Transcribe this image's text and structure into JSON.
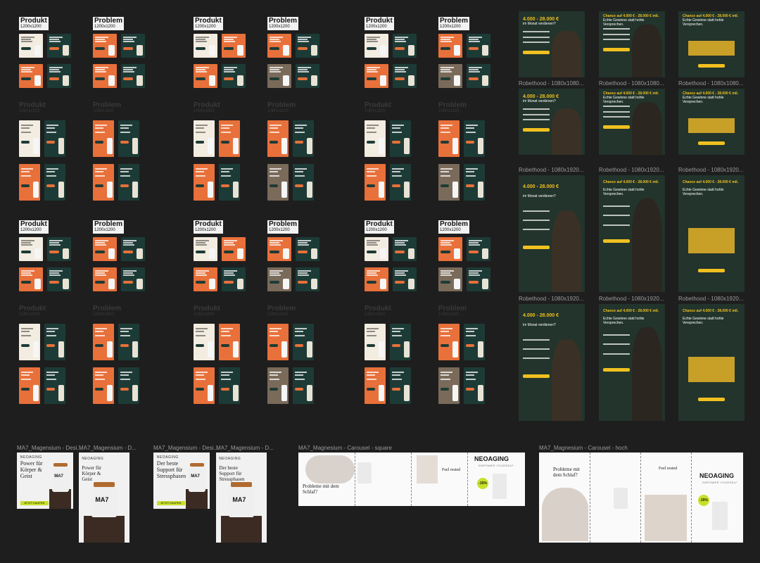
{
  "label_boxes": [
    {
      "title": "Produkt",
      "size": "1200x1200"
    },
    {
      "title": "Problem",
      "size": "1200x1200"
    },
    {
      "title": "Produkt",
      "size": "1200x1200"
    },
    {
      "title": "Problem",
      "size": "1200x1200"
    },
    {
      "title": "Produkt",
      "size": "1200x1200"
    },
    {
      "title": "Problem",
      "size": "1200x1200"
    },
    {
      "title": "Produkt",
      "size": "1200x1200"
    },
    {
      "title": "Problem",
      "size": "1200x1200"
    },
    {
      "title": "Produkt",
      "size": "1200x1200"
    },
    {
      "title": "Problem",
      "size": "1200x1200"
    },
    {
      "title": "Produkt",
      "size": "1200x1200"
    },
    {
      "title": "Problem",
      "size": "1200x1200"
    }
  ],
  "ghost_labels": [
    {
      "title": "Produkt",
      "size": "1080x1920"
    },
    {
      "title": "Problem",
      "size": "1080x1920"
    },
    {
      "title": "Produkt",
      "size": "1080x1920"
    },
    {
      "title": "Problem",
      "size": "1080x1920"
    },
    {
      "title": "Produkt",
      "size": "1080x1920"
    },
    {
      "title": "Problem",
      "size": "1080x1920"
    },
    {
      "title": "Produkt",
      "size": "1080x1920"
    },
    {
      "title": "Problem",
      "size": "1080x1920"
    },
    {
      "title": "Produkt",
      "size": "1080x1920"
    },
    {
      "title": "Problem",
      "size": "1080x1920"
    },
    {
      "title": "Produkt",
      "size": "1080x1920"
    },
    {
      "title": "Problem",
      "size": "1080x1920"
    }
  ],
  "robethood": {
    "labels": [
      "Robethood - 1080x1080...",
      "Robethood - 1080x1080...",
      "Robethood - 1080x1080...",
      "Robethood - 1080x1920...",
      "Robethood - 1080x1920...",
      "Robethood - 1080x1920...",
      "Robethood - 1080x1920...",
      "Robethood - 1080x1920...",
      "Robethood - 1080x1920..."
    ],
    "headline_a": "4.000 - 28.000 €",
    "sub_a": "im Monat verdienen?",
    "headline_b": "Chance auf 4.000 € - 28.000 € mtl.",
    "sub_b": "Echte Gewinne statt hohle Versprechen.",
    "checks": [
      "Kein Verkaufen",
      "Kein Social Media",
      "Keine Vorerfahrung nötig"
    ],
    "cta": "JETZT SYSTEM PRÜFEN"
  },
  "magnesium": {
    "labels": [
      "MA7_Magensium - Desi...",
      "MA7_Magensium - D...",
      "MA7_Magensium - Desi...",
      "MA7_Magensium - D...",
      "MA7_Magnesium - Carousel - square",
      "MA7_Magnesium - Carousel - hoch"
    ],
    "headline_1": "Power für Körper & Geist",
    "headline_2": "Der beste Support für Stressphasen",
    "product": "MA7",
    "brand": "NEOAGING",
    "cta": "JETZT KAUFEN",
    "carousel_brand": "NEOAGING",
    "carousel_tagline": "EMPOWER YOURSELF",
    "carousel_q": "Probleme mit dem Schlaf?",
    "carousel_rested": "Feel rested",
    "carousel_badge": "-15%"
  },
  "colors": {
    "background": "#1e1e1e",
    "orange": "#e8703a",
    "teal": "#1d3b36",
    "cream": "#f3ece0",
    "yellow": "#f0c020",
    "lime": "#c8e02a"
  }
}
